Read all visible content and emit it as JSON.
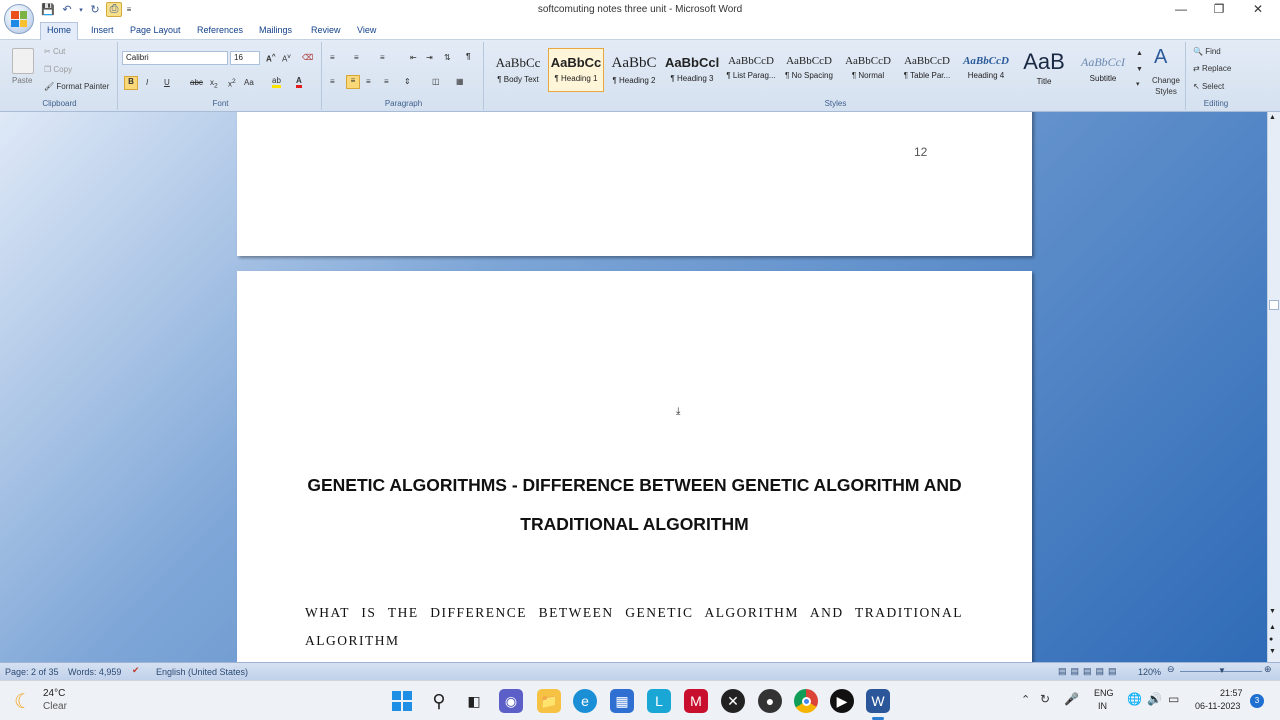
{
  "window": {
    "title": "softcomuting notes three unit - Microsoft Word"
  },
  "tabs": [
    "Home",
    "Insert",
    "Page Layout",
    "References",
    "Mailings",
    "Review",
    "View"
  ],
  "clipboard": {
    "paste": "Paste",
    "cut": "Cut",
    "copy": "Copy",
    "format_painter": "Format Painter",
    "label": "Clipboard"
  },
  "font": {
    "name": "Calibri",
    "size": "16",
    "label": "Font"
  },
  "paragraph": {
    "label": "Paragraph"
  },
  "styles": {
    "label": "Styles",
    "items": [
      {
        "preview": "AaBbCc",
        "name": "¶ Body Text"
      },
      {
        "preview": "AaBbCc",
        "name": "¶ Heading 1"
      },
      {
        "preview": "AaBbC",
        "name": "¶ Heading 2"
      },
      {
        "preview": "AaBbCcl",
        "name": "¶ Heading 3"
      },
      {
        "preview": "AaBbCcD",
        "name": "¶ List Parag..."
      },
      {
        "preview": "AaBbCcD",
        "name": "¶ No Spacing"
      },
      {
        "preview": "AaBbCcD",
        "name": "¶ Normal"
      },
      {
        "preview": "AaBbCcD",
        "name": "¶ Table Par..."
      },
      {
        "preview": "AaBbCcD",
        "name": "Heading 4"
      },
      {
        "preview": "AaB",
        "name": "Title"
      },
      {
        "preview": "AaBbCcI",
        "name": "Subtitle"
      }
    ],
    "change_styles": "Change Styles"
  },
  "editing": {
    "find": "Find",
    "replace": "Replace",
    "select": "Select",
    "label": "Editing"
  },
  "document": {
    "page_number": "12",
    "heading": "GENETIC ALGORITHMS - DIFFERENCE BETWEEN GENETIC ALGORITHM AND TRADITIONAL ALGORITHM",
    "subheading": "WHAT IS THE DIFFERENCE BETWEEN GENETIC ALGORITHM AND TRADITIONAL ALGORITHM"
  },
  "status": {
    "page": "Page: 2 of 35",
    "words": "Words: 4,959",
    "language": "English (United States)",
    "zoom": "120%"
  },
  "taskbar": {
    "temp": "24°C",
    "weather": "Clear",
    "lang1": "ENG",
    "lang2": "IN",
    "time": "21:57",
    "date": "06-11-2023",
    "badge": "3"
  },
  "colors": {
    "accent": "#2b579a",
    "ribbon": "#dfe8f5"
  }
}
